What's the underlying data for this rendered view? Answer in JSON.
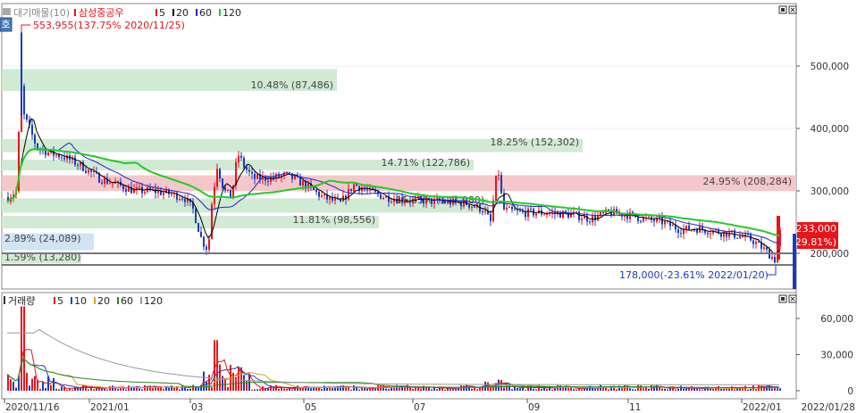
{
  "price_legend": {
    "mode": "대기매물(10)",
    "stock": "삼성중공우",
    "ma_labels": [
      "5",
      "20",
      "60",
      "120"
    ],
    "ma_colors": [
      "#e8141b",
      "#000000",
      "#2222cc",
      "#22cc22"
    ]
  },
  "volume_legend": {
    "title": "거래량",
    "ma_labels": [
      "5",
      "10",
      "20",
      "60",
      "120"
    ],
    "ma_colors": [
      "#e8141b",
      "#2244cc",
      "#e0a020",
      "#228822",
      "#999999"
    ]
  },
  "side_button": "호",
  "annotations": {
    "high": "553,955(137.75% 2020/11/25)",
    "low": "178,000(-23.61% 2022/01/20)"
  },
  "last_price": {
    "value": "233,000",
    "change": "( 29.81%)"
  },
  "price_axis": {
    "ticks": [
      {
        "label": "500,000",
        "value": 500000
      },
      {
        "label": "400,000",
        "value": 400000
      },
      {
        "label": "300,000",
        "value": 300000
      },
      {
        "label": "200,000",
        "value": 200000
      }
    ]
  },
  "volume_axis": {
    "ticks": [
      {
        "label": "60,000",
        "value": 60000
      },
      {
        "label": "30,000",
        "value": 30000
      },
      {
        "label": "0",
        "value": 0
      }
    ]
  },
  "x_axis": {
    "ticks": [
      "2020/11/16",
      "2021/01",
      "03",
      "05",
      "07",
      "09",
      "11",
      "2022/01"
    ],
    "last_date": "2022/01/28"
  },
  "chart_data": {
    "type": "bar",
    "title": "대기매물(10) 삼성중공우",
    "price_range": [
      140000,
      560000
    ],
    "volume_profile": [
      {
        "label": "10.48% (87,486)",
        "price_low": 460000,
        "price_high": 495000,
        "highlight": false
      },
      {
        "label": "18.25% (152,302)",
        "price_low": 383000,
        "price_high": 362000,
        "highlight": false
      },
      {
        "label": "14.71% (122,786)",
        "price_low": 350000,
        "price_high": 333000,
        "highlight": false
      },
      {
        "label": "24.95% (208,284)",
        "price_low": 300000,
        "price_high": 325000,
        "highlight": true
      },
      {
        "label": "15.35% (127,980)",
        "price_low": 265000,
        "price_high": 288000,
        "highlight": false
      },
      {
        "label": "11.81% (98,556)",
        "price_low": 240000,
        "price_high": 260000,
        "highlight": false
      },
      {
        "label": "2.89% (24,089)",
        "price_low": 205000,
        "price_high": 232000,
        "highlight": false
      },
      {
        "label": "1.59% (13,280)",
        "price_low": 185000,
        "price_high": 198000,
        "highlight": false
      }
    ],
    "high": {
      "value": 553955,
      "date": "2020/11/25",
      "pct": 137.75
    },
    "low": {
      "value": 178000,
      "date": "2022/01/20",
      "pct": -23.61
    },
    "last": 233000
  }
}
